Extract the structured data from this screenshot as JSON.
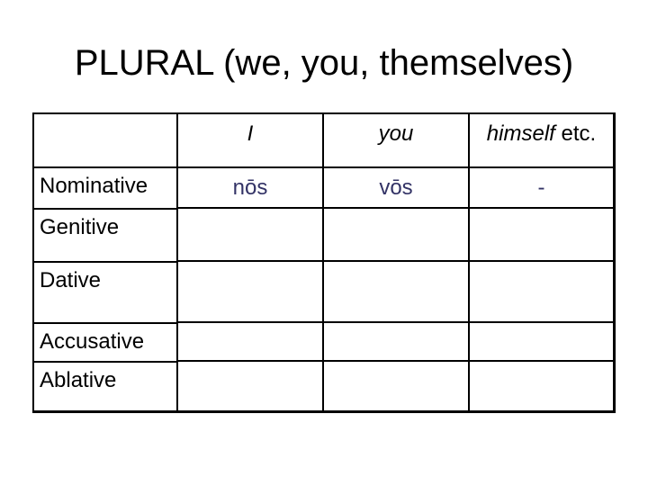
{
  "title": "PLURAL (we, you, themselves)",
  "colors": {
    "text": "#000000",
    "value_text": "#333366",
    "border": "#000000",
    "background": "#ffffff"
  },
  "table": {
    "headers": {
      "case": "",
      "col1": "I",
      "col2": "you",
      "col3_italic": "himself",
      "col3_plain": " etc."
    },
    "rows": [
      {
        "case": "Nominative",
        "col1": "nōs",
        "col2": "vōs",
        "col3": "-"
      },
      {
        "case": "Genitive",
        "col1": "",
        "col2": "",
        "col3": ""
      },
      {
        "case": "Dative",
        "col1": "",
        "col2": "",
        "col3": ""
      },
      {
        "case": "Accusative",
        "col1": "",
        "col2": "",
        "col3": ""
      },
      {
        "case": "Ablative",
        "col1": "",
        "col2": "",
        "col3": ""
      }
    ]
  }
}
